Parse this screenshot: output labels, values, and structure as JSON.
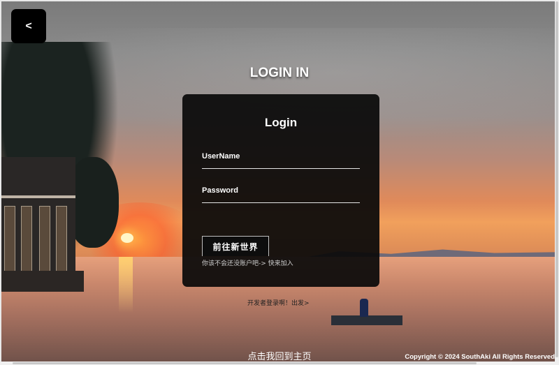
{
  "back_button": {
    "label": "<"
  },
  "page_heading": "LOGIN IN",
  "login_card": {
    "title": "Login",
    "username": {
      "label": "UserName",
      "value": "",
      "placeholder": ""
    },
    "password": {
      "label": "Password",
      "value": "",
      "placeholder": ""
    },
    "submit_label": "前往新世界",
    "register_prompt": "你该不会还没账户吧-> ",
    "register_link": "快来加入"
  },
  "developer_link": "开发者登录啊！出发>",
  "home_link": "点击我回到主页",
  "copyright": "Copyright © 2024 SouthAki All Rights Reserved",
  "colors": {
    "card_bg": "#0a0a0a",
    "text": "#ffffff",
    "back_button_bg": "#000000"
  },
  "icons": {
    "back": "chevron-left-icon"
  }
}
